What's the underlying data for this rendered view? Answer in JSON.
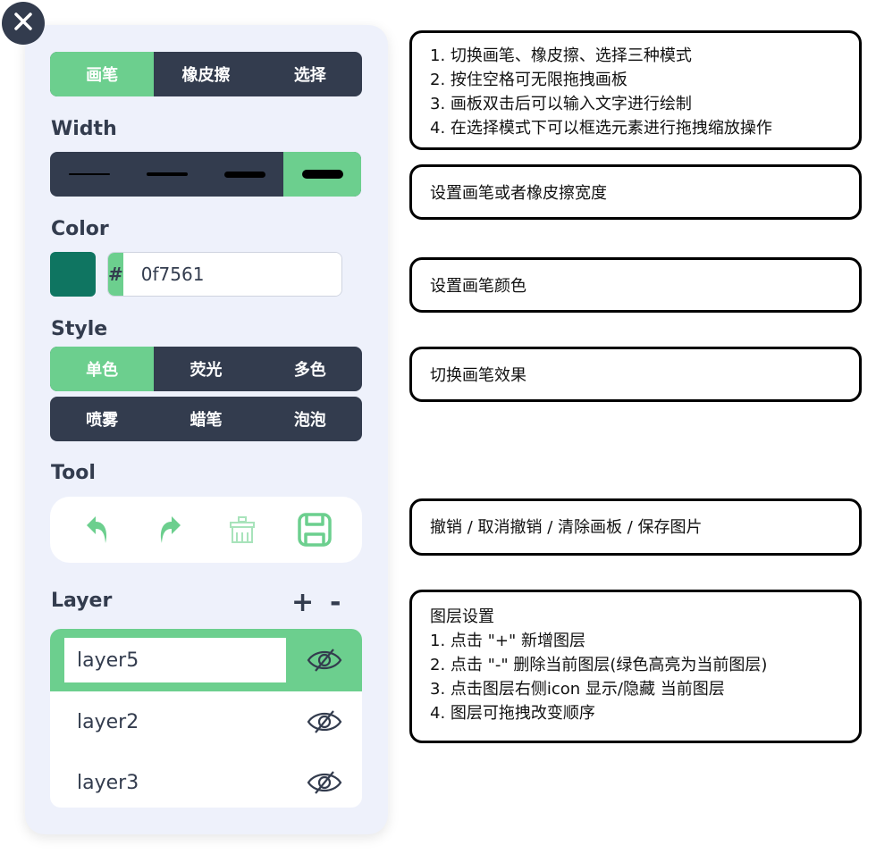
{
  "mode": {
    "items": [
      "画笔",
      "橡皮擦",
      "选择"
    ],
    "active": 0
  },
  "width": {
    "heading": "Width",
    "options": [
      2,
      4,
      6,
      8
    ],
    "active": 3
  },
  "color": {
    "heading": "Color",
    "hash": "#",
    "value": "0f7561",
    "swatch": "#0f7561"
  },
  "style": {
    "heading": "Style",
    "row1": [
      "单色",
      "荧光",
      "多色"
    ],
    "row2": [
      "喷雾",
      "蜡笔",
      "泡泡"
    ],
    "active": 0
  },
  "tool": {
    "heading": "Tool",
    "icons": [
      "undo-icon",
      "redo-icon",
      "clear-board-icon",
      "save-image-icon"
    ]
  },
  "layer": {
    "heading": "Layer",
    "add_label": "+",
    "remove_label": "-",
    "items": [
      {
        "name": "layer5",
        "active": true
      },
      {
        "name": "layer2",
        "active": false
      },
      {
        "name": "layer3",
        "active": false
      }
    ]
  },
  "notes": {
    "n1": [
      "1. 切换画笔、橡皮擦、选择三种模式",
      "2. 按住空格可无限拖拽画板",
      "3. 画板双击后可以输入文字进行绘制",
      "4. 在选择模式下可以框选元素进行拖拽缩放操作"
    ],
    "n2": [
      "设置画笔或者橡皮擦宽度"
    ],
    "n3": [
      "设置画笔颜色"
    ],
    "n4": [
      "切换画笔效果"
    ],
    "n5": [
      "撤销 / 取消撤销 / 清除画板 / 保存图片"
    ],
    "n6": [
      "图层设置",
      "1. 点击 \"+\" 新增图层",
      "2. 点击 \"-\" 删除当前图层(绿色高亮为当前图层)",
      "3. 点击图层右侧icon 显示/隐藏 当前图层",
      "4. 图层可拖拽改变顺序"
    ]
  },
  "colors": {
    "dark": "#333c4e",
    "accent": "#6ccf8e",
    "panel": "#eef1fb"
  }
}
